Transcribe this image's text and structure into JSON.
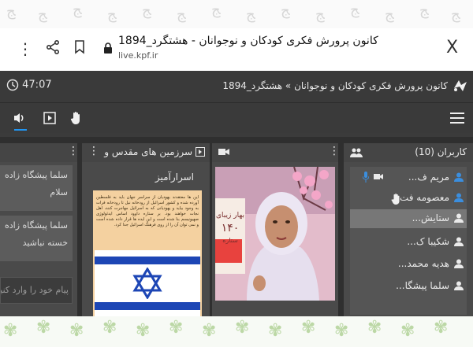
{
  "browser": {
    "page_title": "کانون پرورش فکری کودکان و نوجوانان - هشتگرد_1894",
    "url": "live.kpf.ir",
    "close_label": "X"
  },
  "classroom": {
    "timer": "47:07",
    "title": "کانون پرورش فکری کودکان و نوجوانان » هشتگرد_1894"
  },
  "toolbar": {
    "icons": [
      "speaker-icon",
      "play-icon",
      "hand-icon",
      "hamburger-icon"
    ],
    "accent_color": "#2196f3"
  },
  "chat": {
    "messages": [
      {
        "name": "سلما پیشگاه زاده",
        "text": "سلام"
      },
      {
        "name": "سلما پیشگاه زاده",
        "text": "خسته نباشید"
      }
    ],
    "input_placeholder": "پیام خود را وارد کنید"
  },
  "document": {
    "title_line1": "سرزمین های مقدس و",
    "title_line2": "اسرارآمیز",
    "page_text": "این ها معتقدند یهودیان از سراسر جهان باید به فلسطین آورده شده و کشور اسرائیل از رودخانه نیل تا رودخانه فرات به وجود بیاید و یهودیانی که به اسرائیل مهاجرت کنند، اهل نجات خواهند بود. بر ستاره داوود اساس ایدئولوژی صهیونیسم بنا شده است و این ایده ها قرار داده شده است و نمی توان آن را از روی فرهنگ اسرائیل جدا کرد."
  },
  "video": {
    "poster_line1": "بهار زیبای",
    "poster_number": "۱۴۰",
    "poster_line2": "ستاره"
  },
  "users": {
    "header": "کاربران (10)",
    "list": [
      {
        "name": "مریم ف...",
        "selected": false
      },
      {
        "name": "معصومه فت...",
        "selected": false
      },
      {
        "name": "ستایش...",
        "selected": true
      },
      {
        "name": "شکیبا ک...",
        "selected": false
      },
      {
        "name": "هدیه محمد...",
        "selected": false
      },
      {
        "name": "سلما پیشگا...",
        "selected": false
      }
    ]
  }
}
